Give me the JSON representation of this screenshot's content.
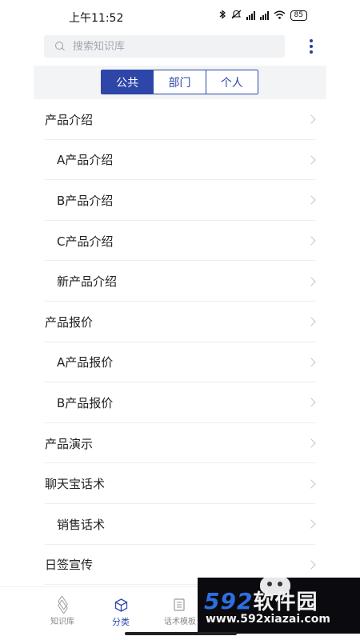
{
  "status_bar": {
    "time": "上午11:52",
    "battery": "85",
    "icons": [
      "bluetooth-icon",
      "mute-icon",
      "signal-icon",
      "signal-icon",
      "wifi-icon",
      "battery-icon"
    ]
  },
  "search": {
    "placeholder": "搜索知识库",
    "value": ""
  },
  "header": {
    "more_icon": "more-vertical-icon"
  },
  "tabs": [
    {
      "label": "公共",
      "active": true
    },
    {
      "label": "部门",
      "active": false
    },
    {
      "label": "个人",
      "active": false
    }
  ],
  "categories": [
    {
      "label": "产品介绍",
      "level": 0
    },
    {
      "label": "A产品介绍",
      "level": 1
    },
    {
      "label": "B产品介绍",
      "level": 1
    },
    {
      "label": "C产品介绍",
      "level": 1
    },
    {
      "label": "新产品介绍",
      "level": 1
    },
    {
      "label": "产品报价",
      "level": 0
    },
    {
      "label": "A产品报价",
      "level": 1
    },
    {
      "label": "B产品报价",
      "level": 1
    },
    {
      "label": "产品演示",
      "level": 0
    },
    {
      "label": "聊天宝话术",
      "level": 0
    },
    {
      "label": "销售话术",
      "level": 1
    },
    {
      "label": "日签宣传",
      "level": 0
    }
  ],
  "bottom_nav": [
    {
      "label": "知识库",
      "icon": "layers-icon",
      "active": false
    },
    {
      "label": "分类",
      "icon": "cube-icon",
      "active": true
    },
    {
      "label": "话术模板",
      "icon": "document-icon",
      "active": false
    }
  ],
  "watermark": {
    "brand_digits": "592",
    "brand_text": "软件园",
    "url": "www.592xiazai.com"
  },
  "colors": {
    "accent": "#2d46a8",
    "divider": "#eeeeee",
    "chevron": "#c4c4c4"
  }
}
